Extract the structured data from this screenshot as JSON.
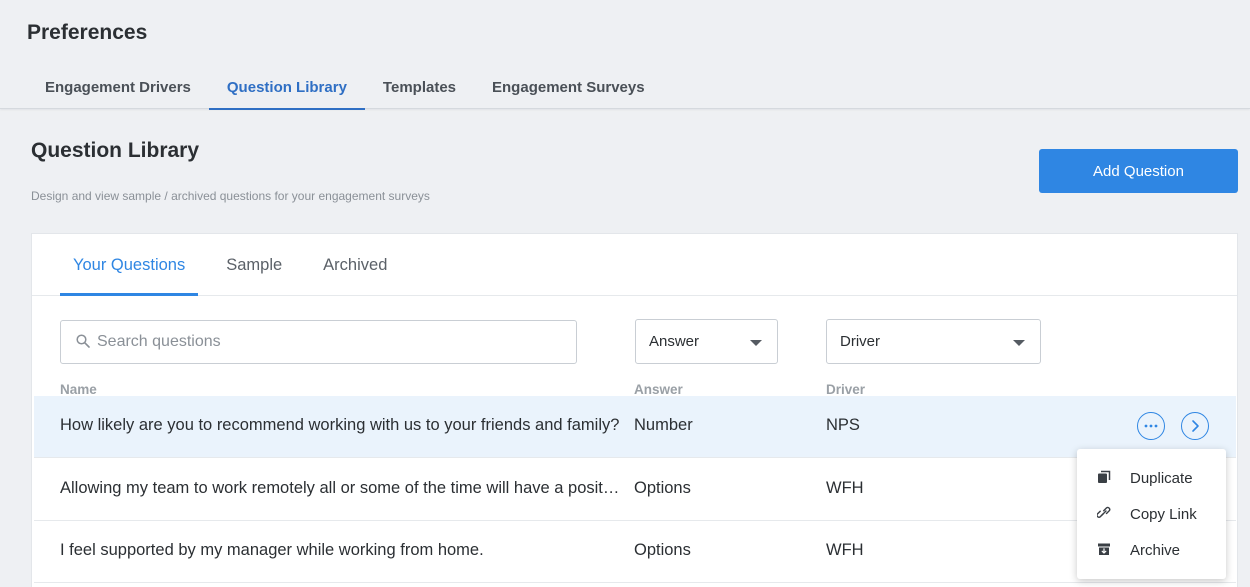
{
  "header": {
    "title": "Preferences",
    "tabs": [
      {
        "label": "Engagement Drivers"
      },
      {
        "label": "Question Library"
      },
      {
        "label": "Templates"
      },
      {
        "label": "Engagement Surveys"
      }
    ],
    "active_tab": "Question Library"
  },
  "section": {
    "title": "Question Library",
    "subtitle": "Design and view sample / archived questions for your engagement surveys",
    "add_button": "Add Question"
  },
  "inner_tabs": [
    {
      "label": "Your Questions"
    },
    {
      "label": "Sample"
    },
    {
      "label": "Archived"
    }
  ],
  "active_inner_tab": "Your Questions",
  "filters": {
    "search_placeholder": "Search questions",
    "answer_value": "Answer",
    "driver_value": "Driver"
  },
  "table": {
    "columns": [
      "Name",
      "Answer",
      "Driver"
    ],
    "rows": [
      {
        "name": "How likely are you to recommend working with us to your friends and family?",
        "answer": "Number",
        "driver": "NPS"
      },
      {
        "name": "Allowing my team to work remotely all or some of the time will have a positive impact",
        "answer": "Options",
        "driver": "WFH"
      },
      {
        "name": "I feel supported by my manager while working from home.",
        "answer": "Options",
        "driver": "WFH"
      }
    ]
  },
  "row_menu": {
    "items": [
      {
        "label": "Duplicate",
        "icon": "duplicate-icon"
      },
      {
        "label": "Copy Link",
        "icon": "link-icon"
      },
      {
        "label": "Archive",
        "icon": "archive-icon"
      }
    ]
  },
  "colors": {
    "accent": "#2f86e3",
    "active_tab": "#2f6fc4",
    "row_highlight": "#eaf3fc"
  }
}
